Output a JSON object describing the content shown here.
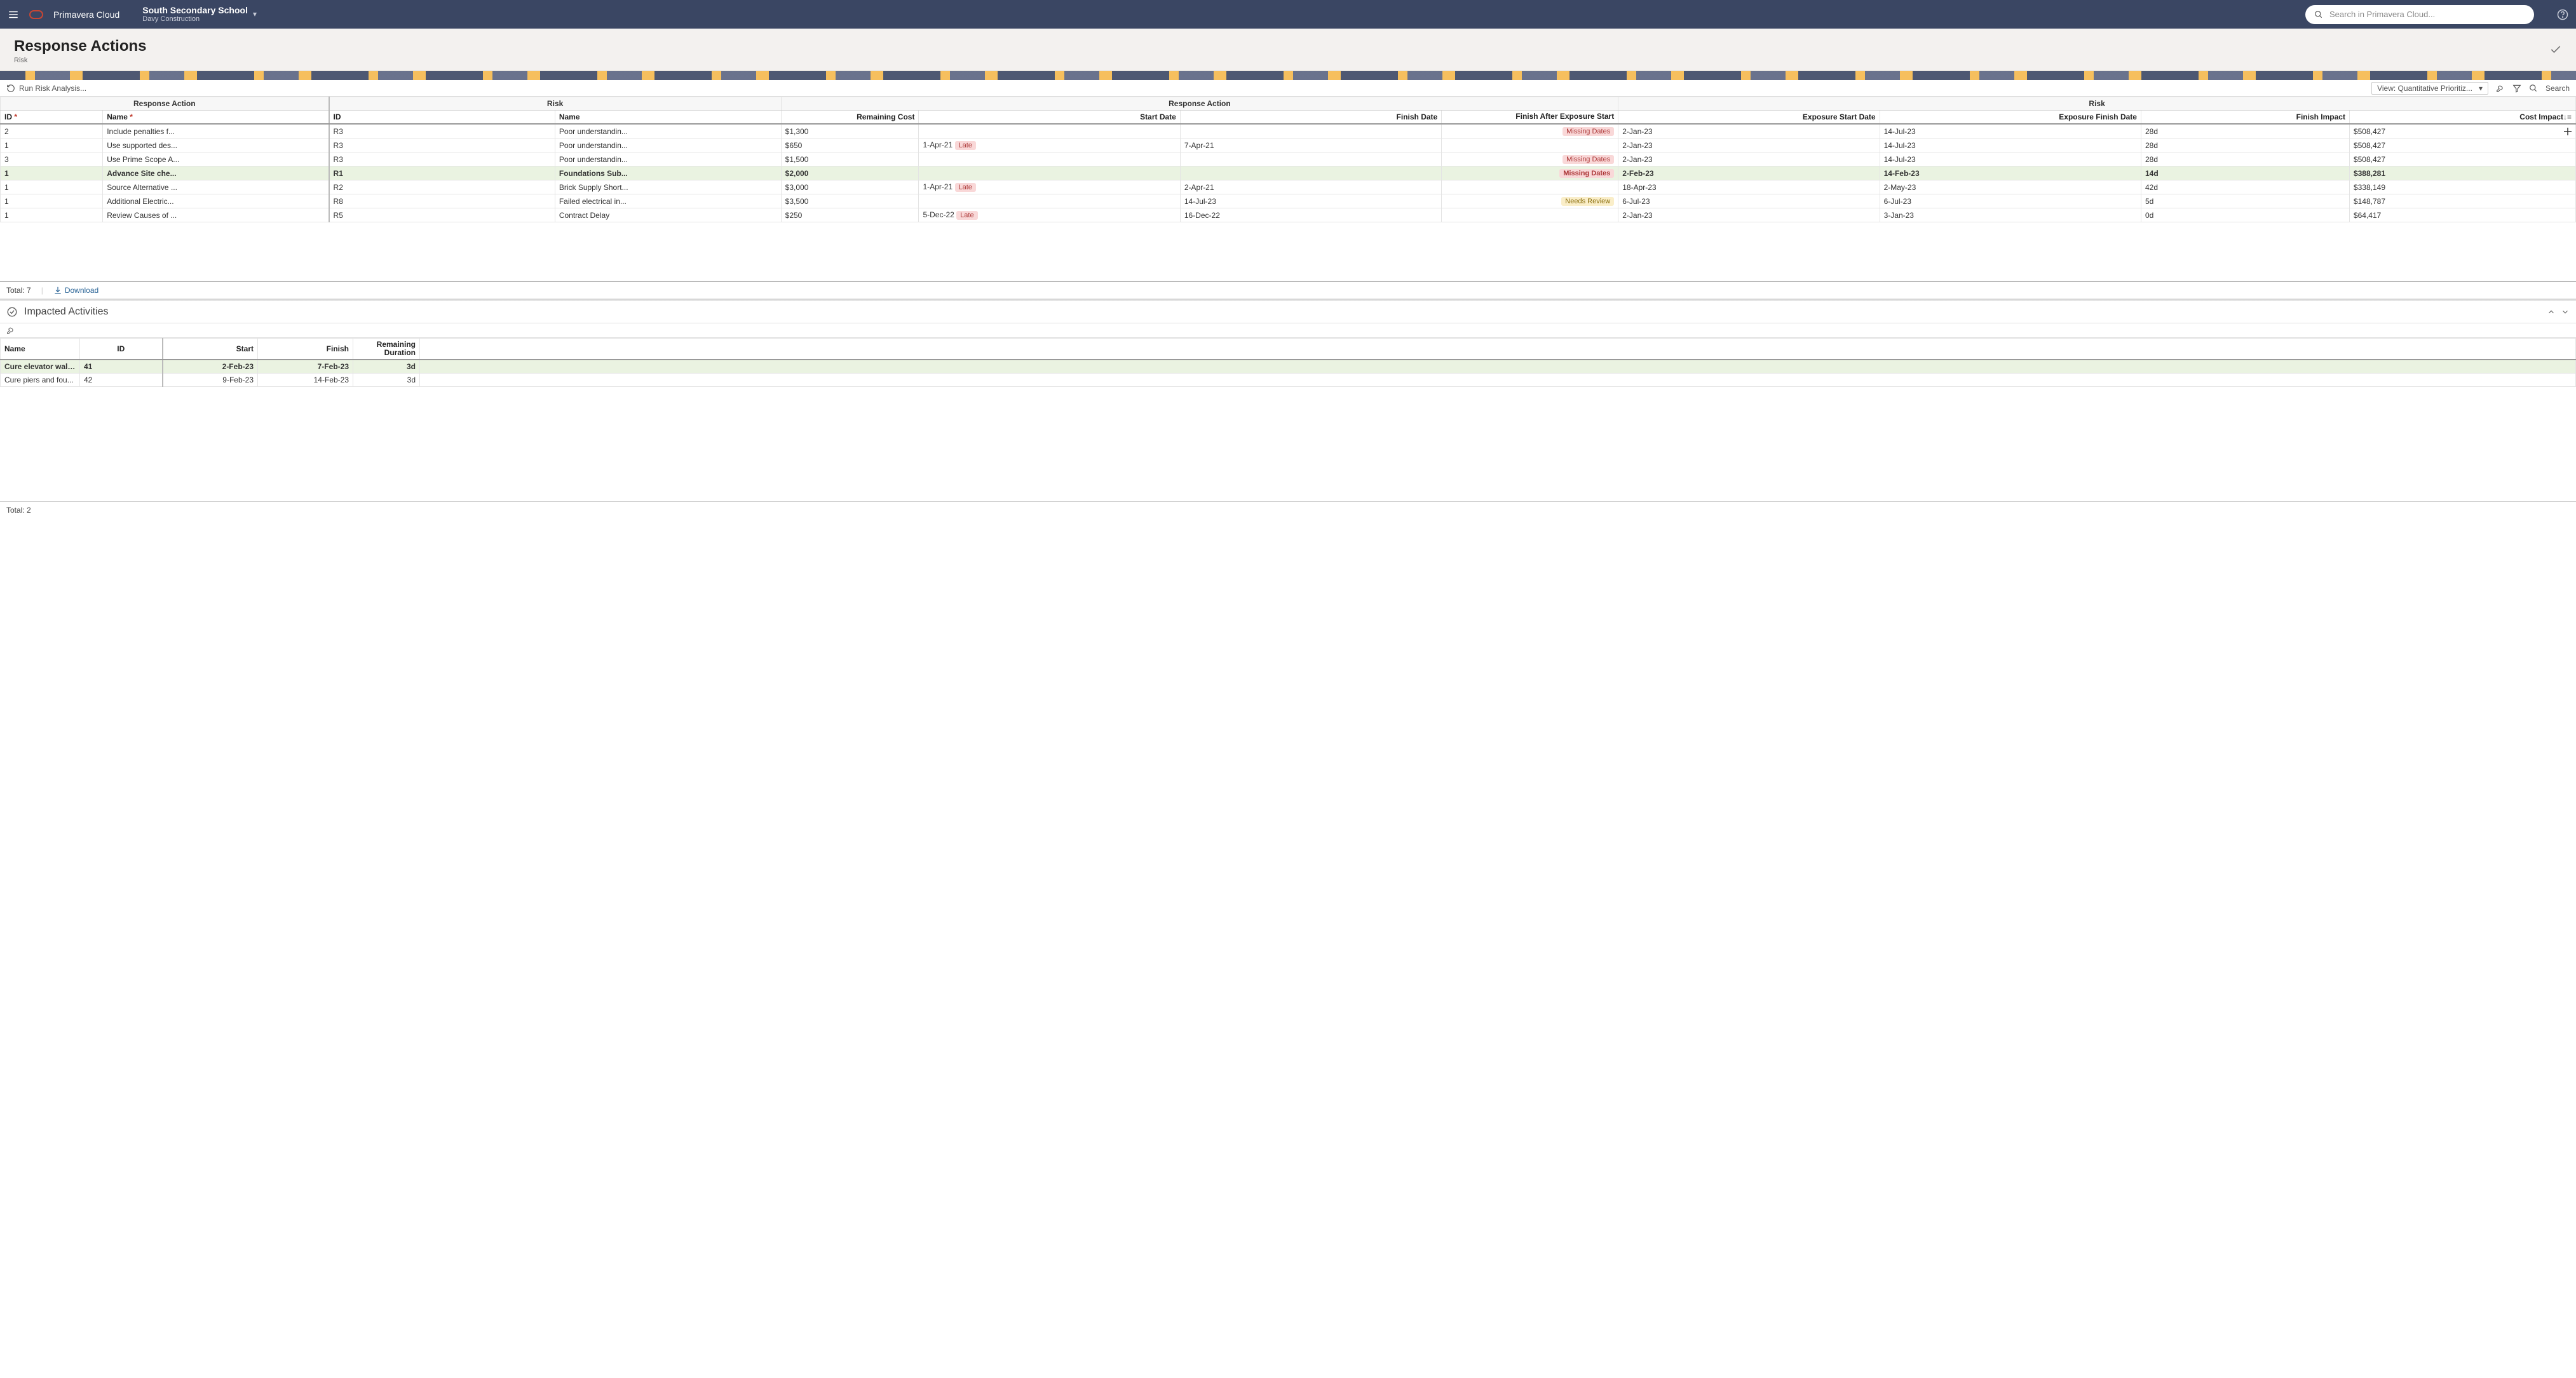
{
  "header": {
    "brand": "Primavera Cloud",
    "context_title": "South Secondary School",
    "context_sub": "Davy Construction",
    "search_placeholder": "Search in Primavera Cloud..."
  },
  "page": {
    "title": "Response Actions",
    "subtitle": "Risk"
  },
  "toolbar": {
    "run_risk": "Run Risk Analysis...",
    "view_label": "View: Quantitative Prioritiz...",
    "search_label": "Search"
  },
  "grid": {
    "group_headers": [
      "Response Action",
      "Risk",
      "Response Action",
      "Risk"
    ],
    "columns": {
      "ra_id": "ID",
      "ra_name": "Name",
      "risk_id": "ID",
      "risk_name": "Name",
      "rem_cost": "Remaining Cost",
      "start": "Start Date",
      "finish": "Finish Date",
      "finish_after": "Finish After Exposure Start",
      "exp_start": "Exposure Start Date",
      "exp_finish": "Exposure Finish Date",
      "fin_impact": "Finish Impact",
      "cost_impact": "Cost Impact"
    },
    "rows": [
      {
        "ra_id": "2",
        "ra_name": "Include penalties f...",
        "risk_id": "R3",
        "risk_name": "Poor understandin...",
        "rem_cost": "$1,300",
        "start": "",
        "start_badge": "",
        "finish": "",
        "after_badge": "Missing Dates",
        "exp_start": "2-Jan-23",
        "exp_finish": "14-Jul-23",
        "fin_impact": "28d",
        "cost_impact": "$508,427",
        "sel": false
      },
      {
        "ra_id": "1",
        "ra_name": "Use supported des...",
        "risk_id": "R3",
        "risk_name": "Poor understandin...",
        "rem_cost": "$650",
        "start": "1-Apr-21",
        "start_badge": "Late",
        "finish": "7-Apr-21",
        "after_badge": "",
        "exp_start": "2-Jan-23",
        "exp_finish": "14-Jul-23",
        "fin_impact": "28d",
        "cost_impact": "$508,427",
        "sel": false
      },
      {
        "ra_id": "3",
        "ra_name": "Use Prime Scope A...",
        "risk_id": "R3",
        "risk_name": "Poor understandin...",
        "rem_cost": "$1,500",
        "start": "",
        "start_badge": "",
        "finish": "",
        "after_badge": "Missing Dates",
        "exp_start": "2-Jan-23",
        "exp_finish": "14-Jul-23",
        "fin_impact": "28d",
        "cost_impact": "$508,427",
        "sel": false
      },
      {
        "ra_id": "1",
        "ra_name": "Advance Site che...",
        "risk_id": "R1",
        "risk_name": "Foundations Sub...",
        "rem_cost": "$2,000",
        "start": "",
        "start_badge": "",
        "finish": "",
        "after_badge": "Missing Dates",
        "exp_start": "2-Feb-23",
        "exp_finish": "14-Feb-23",
        "fin_impact": "14d",
        "cost_impact": "$388,281",
        "sel": true
      },
      {
        "ra_id": "1",
        "ra_name": "Source Alternative ...",
        "risk_id": "R2",
        "risk_name": "Brick Supply Short...",
        "rem_cost": "$3,000",
        "start": "1-Apr-21",
        "start_badge": "Late",
        "finish": "2-Apr-21",
        "after_badge": "",
        "exp_start": "18-Apr-23",
        "exp_finish": "2-May-23",
        "fin_impact": "42d",
        "cost_impact": "$338,149",
        "sel": false
      },
      {
        "ra_id": "1",
        "ra_name": "Additional Electric...",
        "risk_id": "R8",
        "risk_name": "Failed electrical in...",
        "rem_cost": "$3,500",
        "start": "",
        "start_badge": "",
        "finish": "14-Jul-23",
        "after_badge": "Needs Review",
        "exp_start": "6-Jul-23",
        "exp_finish": "6-Jul-23",
        "fin_impact": "5d",
        "cost_impact": "$148,787",
        "sel": false
      },
      {
        "ra_id": "1",
        "ra_name": "Review Causes of ...",
        "risk_id": "R5",
        "risk_name": "Contract Delay",
        "rem_cost": "$250",
        "start": "5-Dec-22",
        "start_badge": "Late",
        "finish": "16-Dec-22",
        "after_badge": "",
        "exp_start": "2-Jan-23",
        "exp_finish": "3-Jan-23",
        "fin_impact": "0d",
        "cost_impact": "$64,417",
        "sel": false
      }
    ],
    "total_label": "Total: 7",
    "download": "Download"
  },
  "detail": {
    "title": "Impacted Activities",
    "columns": {
      "name": "Name",
      "id": "ID",
      "start": "Start",
      "finish": "Finish",
      "rem_dur": "Remaining Duration"
    },
    "rows": [
      {
        "name": "Cure elevator wall...",
        "id": "41",
        "start": "2-Feb-23",
        "finish": "7-Feb-23",
        "rem_dur": "3d",
        "sel": true
      },
      {
        "name": "Cure piers and fou...",
        "id": "42",
        "start": "9-Feb-23",
        "finish": "14-Feb-23",
        "rem_dur": "3d",
        "sel": false
      }
    ],
    "total_label": "Total: 2"
  }
}
